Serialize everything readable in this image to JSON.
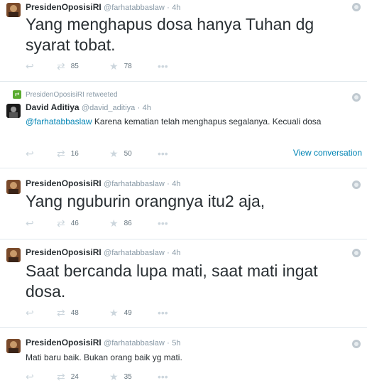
{
  "tweets": [
    {
      "name": "PresidenOposisiRI",
      "handle": "@farhatabbaslaw",
      "separator": "·",
      "time": "4h",
      "text": "Yang menghapus dosa hanya Tuhan dg syarat tobat.",
      "retweets": "85",
      "favorites": "78"
    },
    {
      "retweet_context": "PresidenOposisiRI retweeted",
      "name": "David Aditiya",
      "handle": "@david_aditiya",
      "separator": "·",
      "time": "4h",
      "mention": "@farhatabbaslaw",
      "text": " Karena kematian telah menghapus segalanya. Kecuali dosa",
      "retweets": "16",
      "favorites": "50",
      "view_conversation": "View conversation"
    },
    {
      "name": "PresidenOposisiRI",
      "handle": "@farhatabbaslaw",
      "separator": "·",
      "time": "4h",
      "text": "Yang nguburin orangnya itu2 aja,",
      "retweets": "46",
      "favorites": "86"
    },
    {
      "name": "PresidenOposisiRI",
      "handle": "@farhatabbaslaw",
      "separator": "·",
      "time": "4h",
      "text": "Saat bercanda lupa mati, saat mati ingat dosa.",
      "retweets": "48",
      "favorites": "49"
    },
    {
      "name": "PresidenOposisiRI",
      "handle": "@farhatabbaslaw",
      "separator": "·",
      "time": "5h",
      "text": "Mati baru baik. Bukan orang baik yg mati.",
      "retweets": "24",
      "favorites": "35"
    }
  ],
  "icons": {
    "reply": "reply-icon",
    "retweet": "retweet-icon",
    "favorite": "star-icon",
    "more": "more-icon"
  },
  "colors": {
    "link": "#0084b4",
    "meta": "#8899a6",
    "text": "#292f33"
  }
}
